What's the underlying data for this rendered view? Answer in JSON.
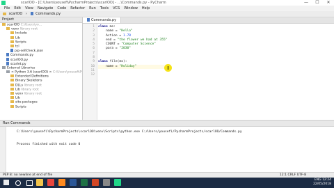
{
  "window": {
    "title": "scarlOO - [C:\\Users\\yousefi\\PycharmProjects\\scarlOO] - ...\\Commands.py - PyCharm",
    "buttons": [
      "—",
      "☐",
      "✕"
    ]
  },
  "menu": [
    "File",
    "Edit",
    "View",
    "Navigate",
    "Code",
    "Refactor",
    "Run",
    "Tools",
    "VCS",
    "Window",
    "Help"
  ],
  "breadcrumb": [
    "scarlOO",
    "Commands.py"
  ],
  "project": {
    "header": "Project",
    "rows": [
      {
        "label": "scarlOO",
        "note": "C:\\Users\\yo...",
        "type": "folder",
        "indent": 0
      },
      {
        "label": "venv",
        "note": "library root",
        "type": "folder",
        "indent": 1
      },
      {
        "label": "Include",
        "note": "",
        "type": "folder",
        "indent": 2
      },
      {
        "label": "Lib",
        "note": "",
        "type": "folder",
        "indent": 2
      },
      {
        "label": "Scripts",
        "note": "",
        "type": "folder",
        "indent": 2
      },
      {
        "label": "tcl",
        "note": "",
        "type": "folder",
        "indent": 2
      },
      {
        "label": "pip-selfcheck.json",
        "note": "",
        "type": "file",
        "indent": 2
      },
      {
        "label": "Commands.py",
        "note": "",
        "type": "file",
        "indent": 1
      },
      {
        "label": "scarlOO.py",
        "note": "",
        "type": "file",
        "indent": 1
      },
      {
        "label": "scarlet.py",
        "note": "",
        "type": "file",
        "indent": 1
      },
      {
        "label": "External Libraries",
        "note": "",
        "type": "lib",
        "indent": 0
      },
      {
        "label": "< Python 3.6 (scarlOO) >",
        "note": "C:\\Users\\yousefi\\PycharmProj...",
        "type": "lib",
        "indent": 1
      },
      {
        "label": "Extended Definitions",
        "note": "",
        "type": "folder",
        "indent": 2
      },
      {
        "label": "Binary Skeletons",
        "note": "",
        "type": "folder",
        "indent": 2
      },
      {
        "label": "DLLs",
        "note": "library root",
        "type": "folder",
        "indent": 2
      },
      {
        "label": "Lib",
        "note": "library root",
        "type": "folder",
        "indent": 2
      },
      {
        "label": "venv",
        "note": "library root",
        "type": "folder",
        "indent": 2
      },
      {
        "label": "Lib",
        "note": "",
        "type": "folder",
        "indent": 2
      },
      {
        "label": "site-packages",
        "note": "",
        "type": "folder",
        "indent": 2
      },
      {
        "label": "Scripts",
        "note": "",
        "type": "folder",
        "indent": 2
      }
    ]
  },
  "editor": {
    "tab": "Commands.py",
    "line_numbers": [
      "1",
      "2",
      "3",
      "4",
      "5",
      "6",
      "7",
      "8",
      "9",
      "10",
      "11",
      "12"
    ],
    "lines": [
      "class mo:",
      "    name = \"Hello\"",
      "    Action = 1.78",
      "    end = \"the flower we had at 355\"",
      "    COUNT = \"Computer Science\"",
      "    para = \"2030\"",
      "",
      "",
      "class file(mo):",
      "    name = \"Holiday\"",
      "",
      ""
    ]
  },
  "run": {
    "header": "Run  Commands",
    "command": "C:\\Users\\yousefi\\PycharmProjects\\scarlOO\\venv\\Scripts\\python.exe C:/Users/yousefi/PycharmProjects/scarlOO/Commands.py",
    "exit": "Process finished with exit code 0"
  },
  "status": {
    "left": "PEP 8: no newline at end of file",
    "right": "12:1  CRLF  UTF-8"
  },
  "taskbar": {
    "lang": "ENG",
    "time": "12:24",
    "date": "22/05/2018",
    "icons": [
      "start-icon",
      "search-icon",
      "task-view-icon",
      "file-explorer-icon",
      "chrome-icon",
      "firefox-icon",
      "word-icon",
      "excel-icon",
      "powerpoint-icon",
      "settings-icon",
      "pycharm-icon"
    ]
  }
}
